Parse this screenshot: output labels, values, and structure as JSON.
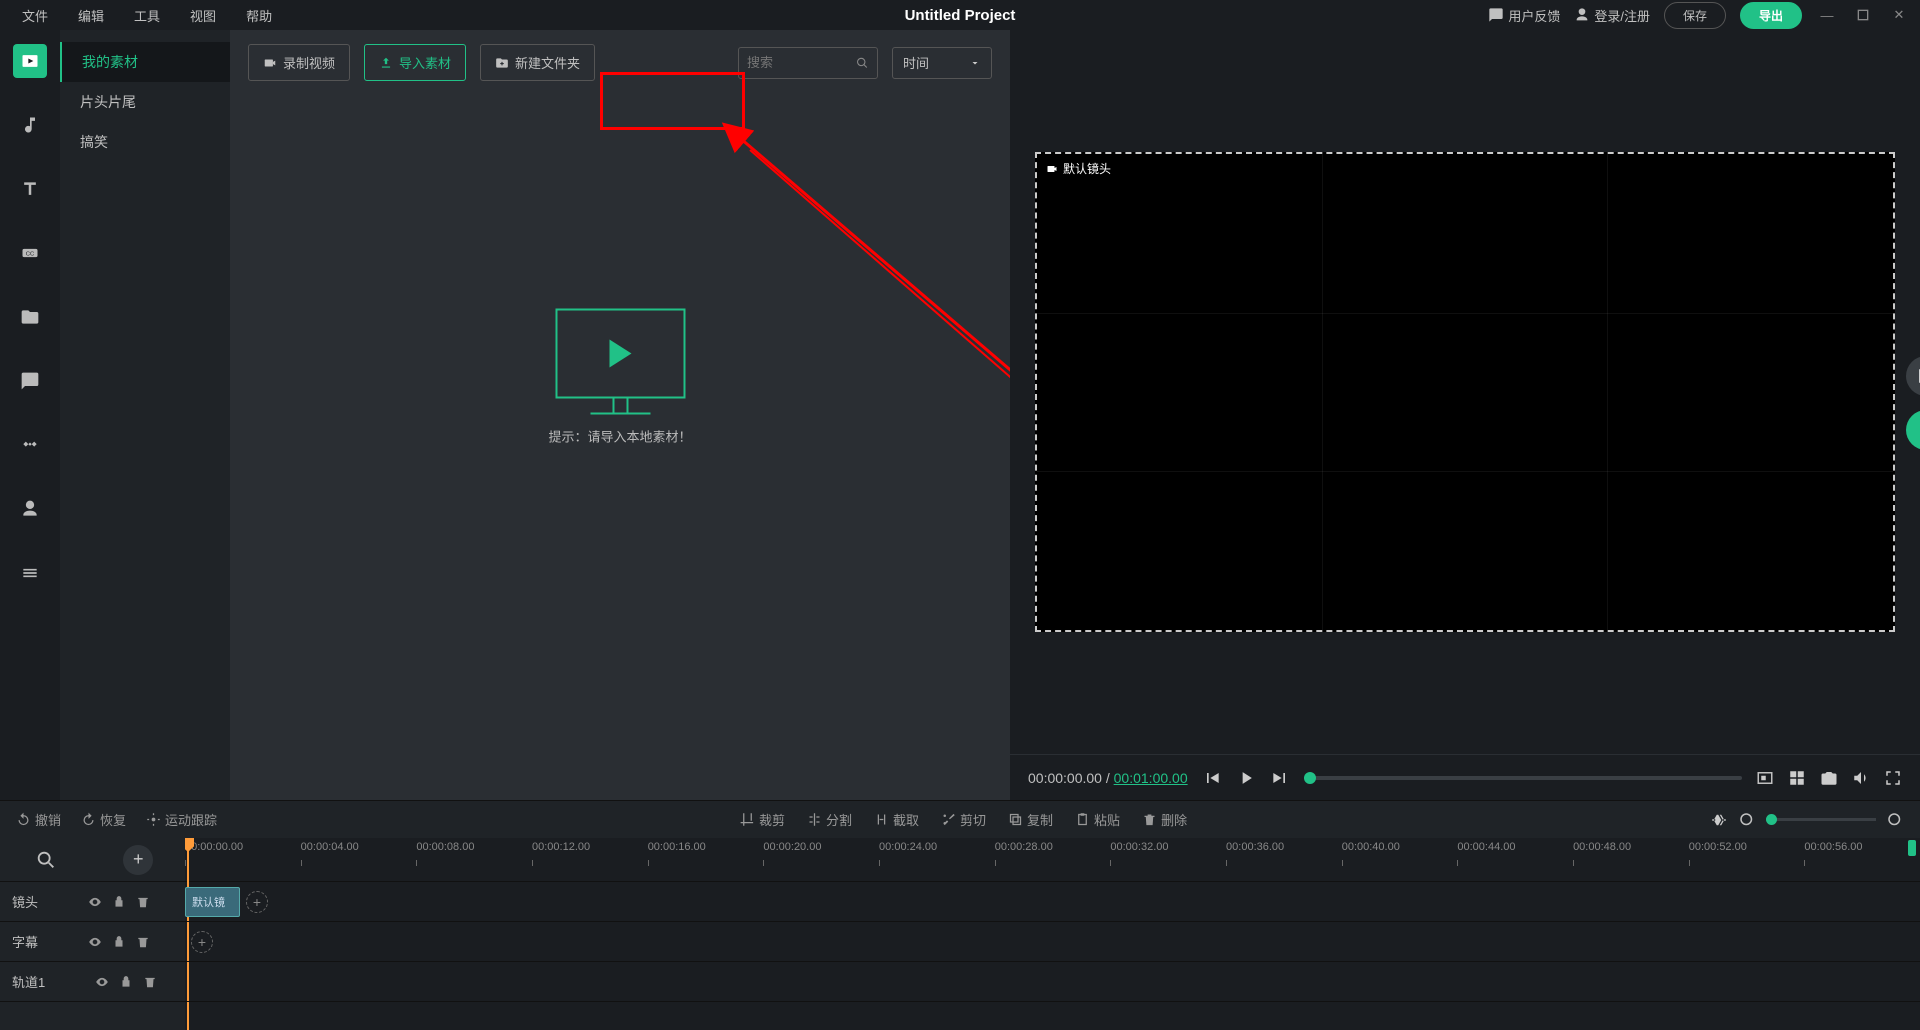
{
  "menu": {
    "items": [
      "文件",
      "编辑",
      "工具",
      "视图",
      "帮助"
    ],
    "project_title": "Untitled Project",
    "feedback": "用户反馈",
    "login": "登录/注册",
    "save": "保存",
    "export": "导出"
  },
  "sidebar_categories": {
    "items": [
      "我的素材",
      "片头片尾",
      "搞笑"
    ],
    "active_index": 0
  },
  "media_toolbar": {
    "record": "录制视频",
    "import": "导入素材",
    "new_folder": "新建文件夹",
    "search_placeholder": "搜索",
    "sort_label": "时间"
  },
  "empty_hint": "提示：请导入本地素材！",
  "preview": {
    "camera_label": "默认镜头",
    "current_time": "00:00:00.00",
    "total_time": "00:01:00.00"
  },
  "tl_toolbar": {
    "undo": "撤销",
    "redo": "恢复",
    "motion_track": "运动跟踪",
    "crop": "裁剪",
    "split": "分割",
    "cut": "截取",
    "trim": "剪切",
    "copy": "复制",
    "paste": "粘贴",
    "delete": "删除"
  },
  "timeline": {
    "ruler_ticks": [
      "00:00:00.00",
      "00:00:04.00",
      "00:00:08.00",
      "00:00:12.00",
      "00:00:16.00",
      "00:00:20.00",
      "00:00:24.00",
      "00:00:28.00",
      "00:00:32.00",
      "00:00:36.00",
      "00:00:40.00",
      "00:00:44.00",
      "00:00:48.00",
      "00:00:52.00",
      "00:00:56.00"
    ],
    "tracks": [
      {
        "name": "镜头",
        "clip": "默认镜"
      },
      {
        "name": "字幕",
        "clip": null
      },
      {
        "name": "轨道1",
        "clip": null
      }
    ]
  },
  "colors": {
    "accent": "#21c187",
    "annotate": "#ff0000"
  }
}
